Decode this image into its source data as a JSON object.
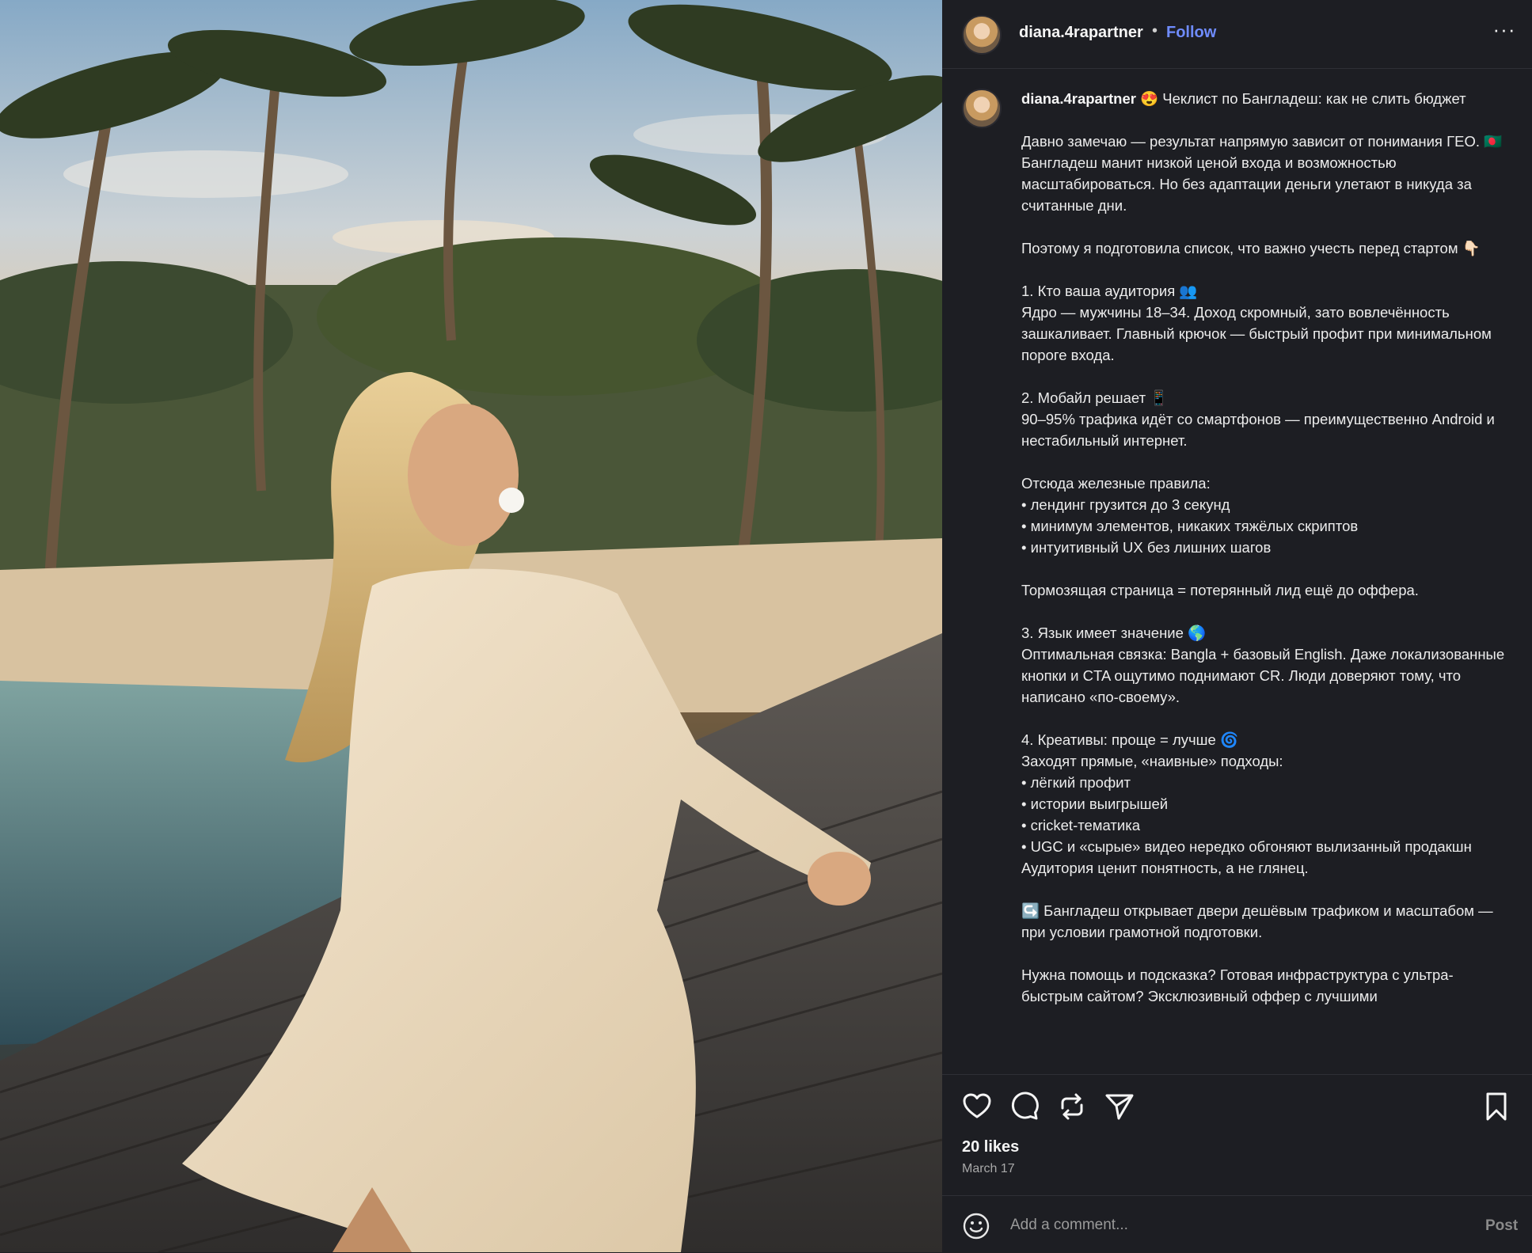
{
  "post": {
    "username": "diana.4rapartner",
    "separator": "•",
    "follow_label": "Follow",
    "more_icon": "more-horizontal-icon",
    "more_glyph": "···",
    "caption_text": " 😍 Чеклист по Бангладеш: как не слить бюджет\n\nДавно замечаю — результат напрямую зависит от понимания ГЕО. 🇧🇩 Бангладеш манит низкой ценой входа и возможностью масштабироваться. Но без адаптации деньги улетают в никуда за считанные дни.\n\nПоэтому я подготовила список, что важно учесть перед стартом 👇🏻\n\n1. Кто ваша аудитория 👥\nЯдро — мужчины 18–34. Доход скромный, зато вовлечённость зашкаливает. Главный крючок — быстрый профит при минимальном пороге входа.\n\n2. Мобайл решает 📱\n90–95% трафика идёт со смартфонов — преимущественно Android и нестабильный интернет.\n\nОтсюда железные правила:\n• лендинг грузится до 3 секунд\n• минимум элементов, никаких тяжёлых скриптов\n• интуитивный UX без лишних шагов\n\nТормозящая страница = потерянный лид ещё до оффера.\n\n3. Язык имеет значение 🌎\nОптимальная связка: Bangla + базовый English. Даже локализованные кнопки и CTA ощутимо поднимают CR. Люди доверяют тому, что написано «по-своему».\n\n4. Креативы: проще = лучше 🌀\nЗаходят прямые, «наивные» подходы:\n• лёгкий профит\n• истории выигрышей\n• cricket-тематика\n• UGC и «сырые» видео нередко обгоняют вылизанный продакшн\nАудитория ценит понятность, а не глянец.\n\n↪️ Бангладеш открывает двери дешёвым трафиком и масштабом — при условии грамотной подготовки.\n\nНужна помощь и подсказка? Готовая инфраструктура с ультра-быстрым сайтом? Эксклюзивный оффер с лучшими",
    "likes": "20 likes",
    "date": "March 17"
  },
  "actions": {
    "like_icon": "heart-icon",
    "comment_icon": "comment-icon",
    "repost_icon": "repost-icon",
    "share_icon": "send-icon",
    "save_icon": "bookmark-icon"
  },
  "comment": {
    "placeholder": "Add a comment...",
    "post_label": "Post",
    "emoji_icon": "emoji-icon"
  },
  "colors": {
    "panel_bg": "#1d1e23",
    "accent": "#6f8cff",
    "text": "#f5f5f5",
    "muted": "#a8a8a8"
  }
}
